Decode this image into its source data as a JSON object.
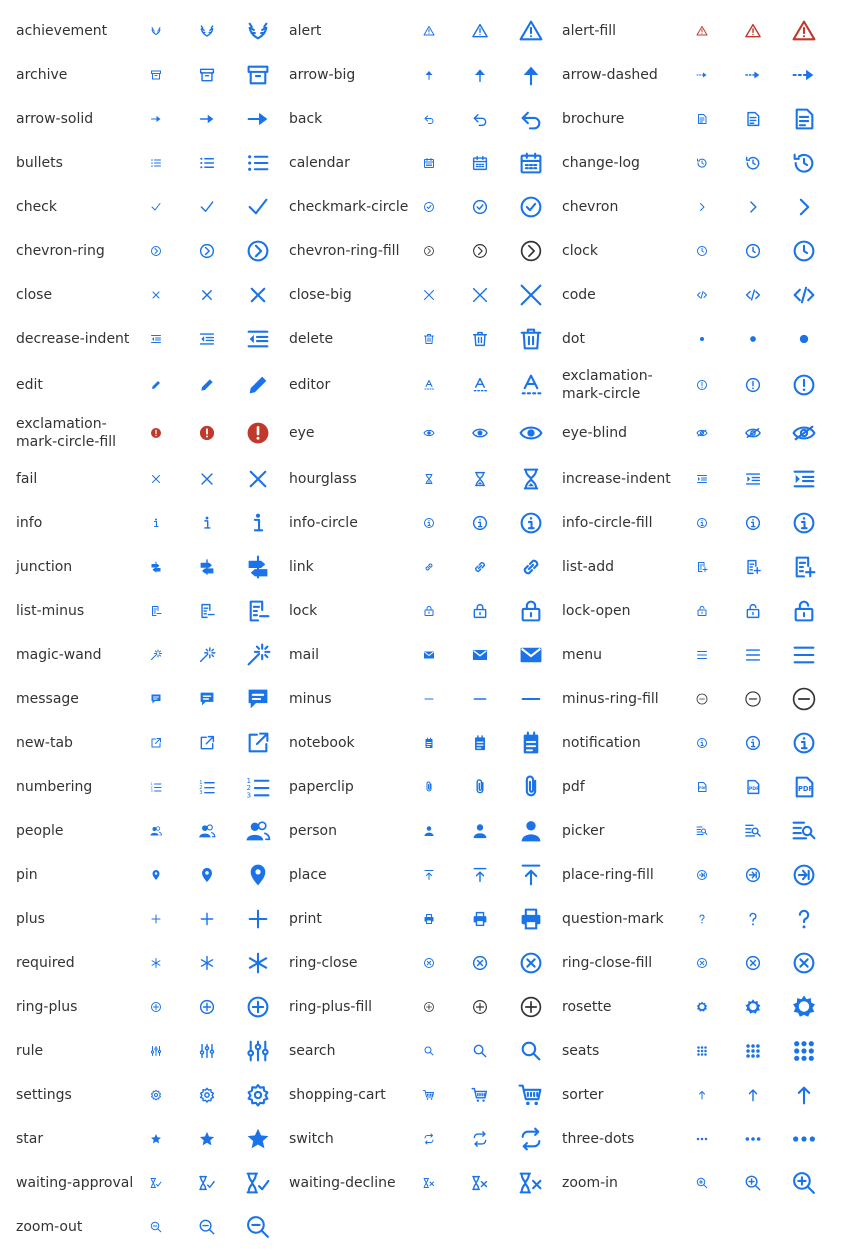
{
  "colors": {
    "blue": "#1a73e8",
    "red": "#c0392b",
    "text": "#333333",
    "outline": "#333333"
  },
  "icons": [
    {
      "name": "achievement",
      "icon": "achievement-icon"
    },
    {
      "name": "alert",
      "icon": "alert-icon"
    },
    {
      "name": "alert-fill",
      "icon": "alert-fill-icon"
    },
    {
      "name": "archive",
      "icon": "archive-icon"
    },
    {
      "name": "arrow-big",
      "icon": "arrow-big-icon"
    },
    {
      "name": "arrow-dashed",
      "icon": "arrow-dashed-icon"
    },
    {
      "name": "arrow-solid",
      "icon": "arrow-solid-icon"
    },
    {
      "name": "back",
      "icon": "back-icon"
    },
    {
      "name": "brochure",
      "icon": "brochure-icon"
    },
    {
      "name": "bullets",
      "icon": "bullets-icon"
    },
    {
      "name": "calendar",
      "icon": "calendar-icon"
    },
    {
      "name": "change-log",
      "icon": "change-log-icon"
    },
    {
      "name": "check",
      "icon": "check-icon"
    },
    {
      "name": "checkmark-circle",
      "icon": "checkmark-circle-icon"
    },
    {
      "name": "chevron",
      "icon": "chevron-icon"
    },
    {
      "name": "chevron-ring",
      "icon": "chevron-ring-icon"
    },
    {
      "name": "chevron-ring-fill",
      "icon": "chevron-ring-fill-icon"
    },
    {
      "name": "clock",
      "icon": "clock-icon"
    },
    {
      "name": "close",
      "icon": "close-icon"
    },
    {
      "name": "close-big",
      "icon": "close-big-icon"
    },
    {
      "name": "code",
      "icon": "code-icon"
    },
    {
      "name": "decrease-indent",
      "icon": "decrease-indent-icon"
    },
    {
      "name": "delete",
      "icon": "delete-icon"
    },
    {
      "name": "dot",
      "icon": "dot-icon"
    },
    {
      "name": "edit",
      "icon": "edit-icon"
    },
    {
      "name": "editor",
      "icon": "editor-icon"
    },
    {
      "name": "exclamation-mark-circle",
      "icon": "exclamation-mark-circle-icon"
    },
    {
      "name": "exclamation-mark-circle-fill",
      "icon": "exclamation-mark-circle-fill-icon"
    },
    {
      "name": "eye",
      "icon": "eye-icon"
    },
    {
      "name": "eye-blind",
      "icon": "eye-blind-icon"
    },
    {
      "name": "fail",
      "icon": "fail-icon"
    },
    {
      "name": "hourglass",
      "icon": "hourglass-icon"
    },
    {
      "name": "increase-indent",
      "icon": "increase-indent-icon"
    },
    {
      "name": "info",
      "icon": "info-icon"
    },
    {
      "name": "info-circle",
      "icon": "info-circle-icon"
    },
    {
      "name": "info-circle-fill",
      "icon": "info-circle-fill-icon"
    },
    {
      "name": "junction",
      "icon": "junction-icon"
    },
    {
      "name": "link",
      "icon": "link-icon"
    },
    {
      "name": "list-add",
      "icon": "list-add-icon"
    },
    {
      "name": "list-minus",
      "icon": "list-minus-icon"
    },
    {
      "name": "lock",
      "icon": "lock-icon"
    },
    {
      "name": "lock-open",
      "icon": "lock-open-icon"
    },
    {
      "name": "magic-wand",
      "icon": "magic-wand-icon"
    },
    {
      "name": "mail",
      "icon": "mail-icon"
    },
    {
      "name": "menu",
      "icon": "menu-icon"
    },
    {
      "name": "message",
      "icon": "message-icon"
    },
    {
      "name": "minus",
      "icon": "minus-icon"
    },
    {
      "name": "minus-ring-fill",
      "icon": "minus-ring-fill-icon"
    },
    {
      "name": "new-tab",
      "icon": "new-tab-icon"
    },
    {
      "name": "notebook",
      "icon": "notebook-icon"
    },
    {
      "name": "notification",
      "icon": "notification-icon"
    },
    {
      "name": "numbering",
      "icon": "numbering-icon"
    },
    {
      "name": "paperclip",
      "icon": "paperclip-icon"
    },
    {
      "name": "pdf",
      "icon": "pdf-icon"
    },
    {
      "name": "people",
      "icon": "people-icon"
    },
    {
      "name": "person",
      "icon": "person-icon"
    },
    {
      "name": "picker",
      "icon": "picker-icon"
    },
    {
      "name": "pin",
      "icon": "pin-icon"
    },
    {
      "name": "place",
      "icon": "place-icon"
    },
    {
      "name": "place-ring-fill",
      "icon": "place-ring-fill-icon"
    },
    {
      "name": "plus",
      "icon": "plus-icon"
    },
    {
      "name": "print",
      "icon": "print-icon"
    },
    {
      "name": "question-mark",
      "icon": "question-mark-icon"
    },
    {
      "name": "required",
      "icon": "required-icon"
    },
    {
      "name": "ring-close",
      "icon": "ring-close-icon"
    },
    {
      "name": "ring-close-fill",
      "icon": "ring-close-fill-icon"
    },
    {
      "name": "ring-plus",
      "icon": "ring-plus-icon"
    },
    {
      "name": "ring-plus-fill",
      "icon": "ring-plus-fill-icon"
    },
    {
      "name": "rosette",
      "icon": "rosette-icon"
    },
    {
      "name": "rule",
      "icon": "rule-icon"
    },
    {
      "name": "search",
      "icon": "search-icon"
    },
    {
      "name": "seats",
      "icon": "seats-icon"
    },
    {
      "name": "settings",
      "icon": "settings-icon"
    },
    {
      "name": "shopping-cart",
      "icon": "shopping-cart-icon"
    },
    {
      "name": "sorter",
      "icon": "sorter-icon"
    },
    {
      "name": "star",
      "icon": "star-icon"
    },
    {
      "name": "switch",
      "icon": "switch-icon"
    },
    {
      "name": "three-dots",
      "icon": "three-dots-icon"
    },
    {
      "name": "waiting-approval",
      "icon": "waiting-approval-icon"
    },
    {
      "name": "waiting-decline",
      "icon": "waiting-decline-icon"
    },
    {
      "name": "zoom-in",
      "icon": "zoom-in-icon"
    },
    {
      "name": "zoom-out",
      "icon": "zoom-out-icon"
    }
  ]
}
